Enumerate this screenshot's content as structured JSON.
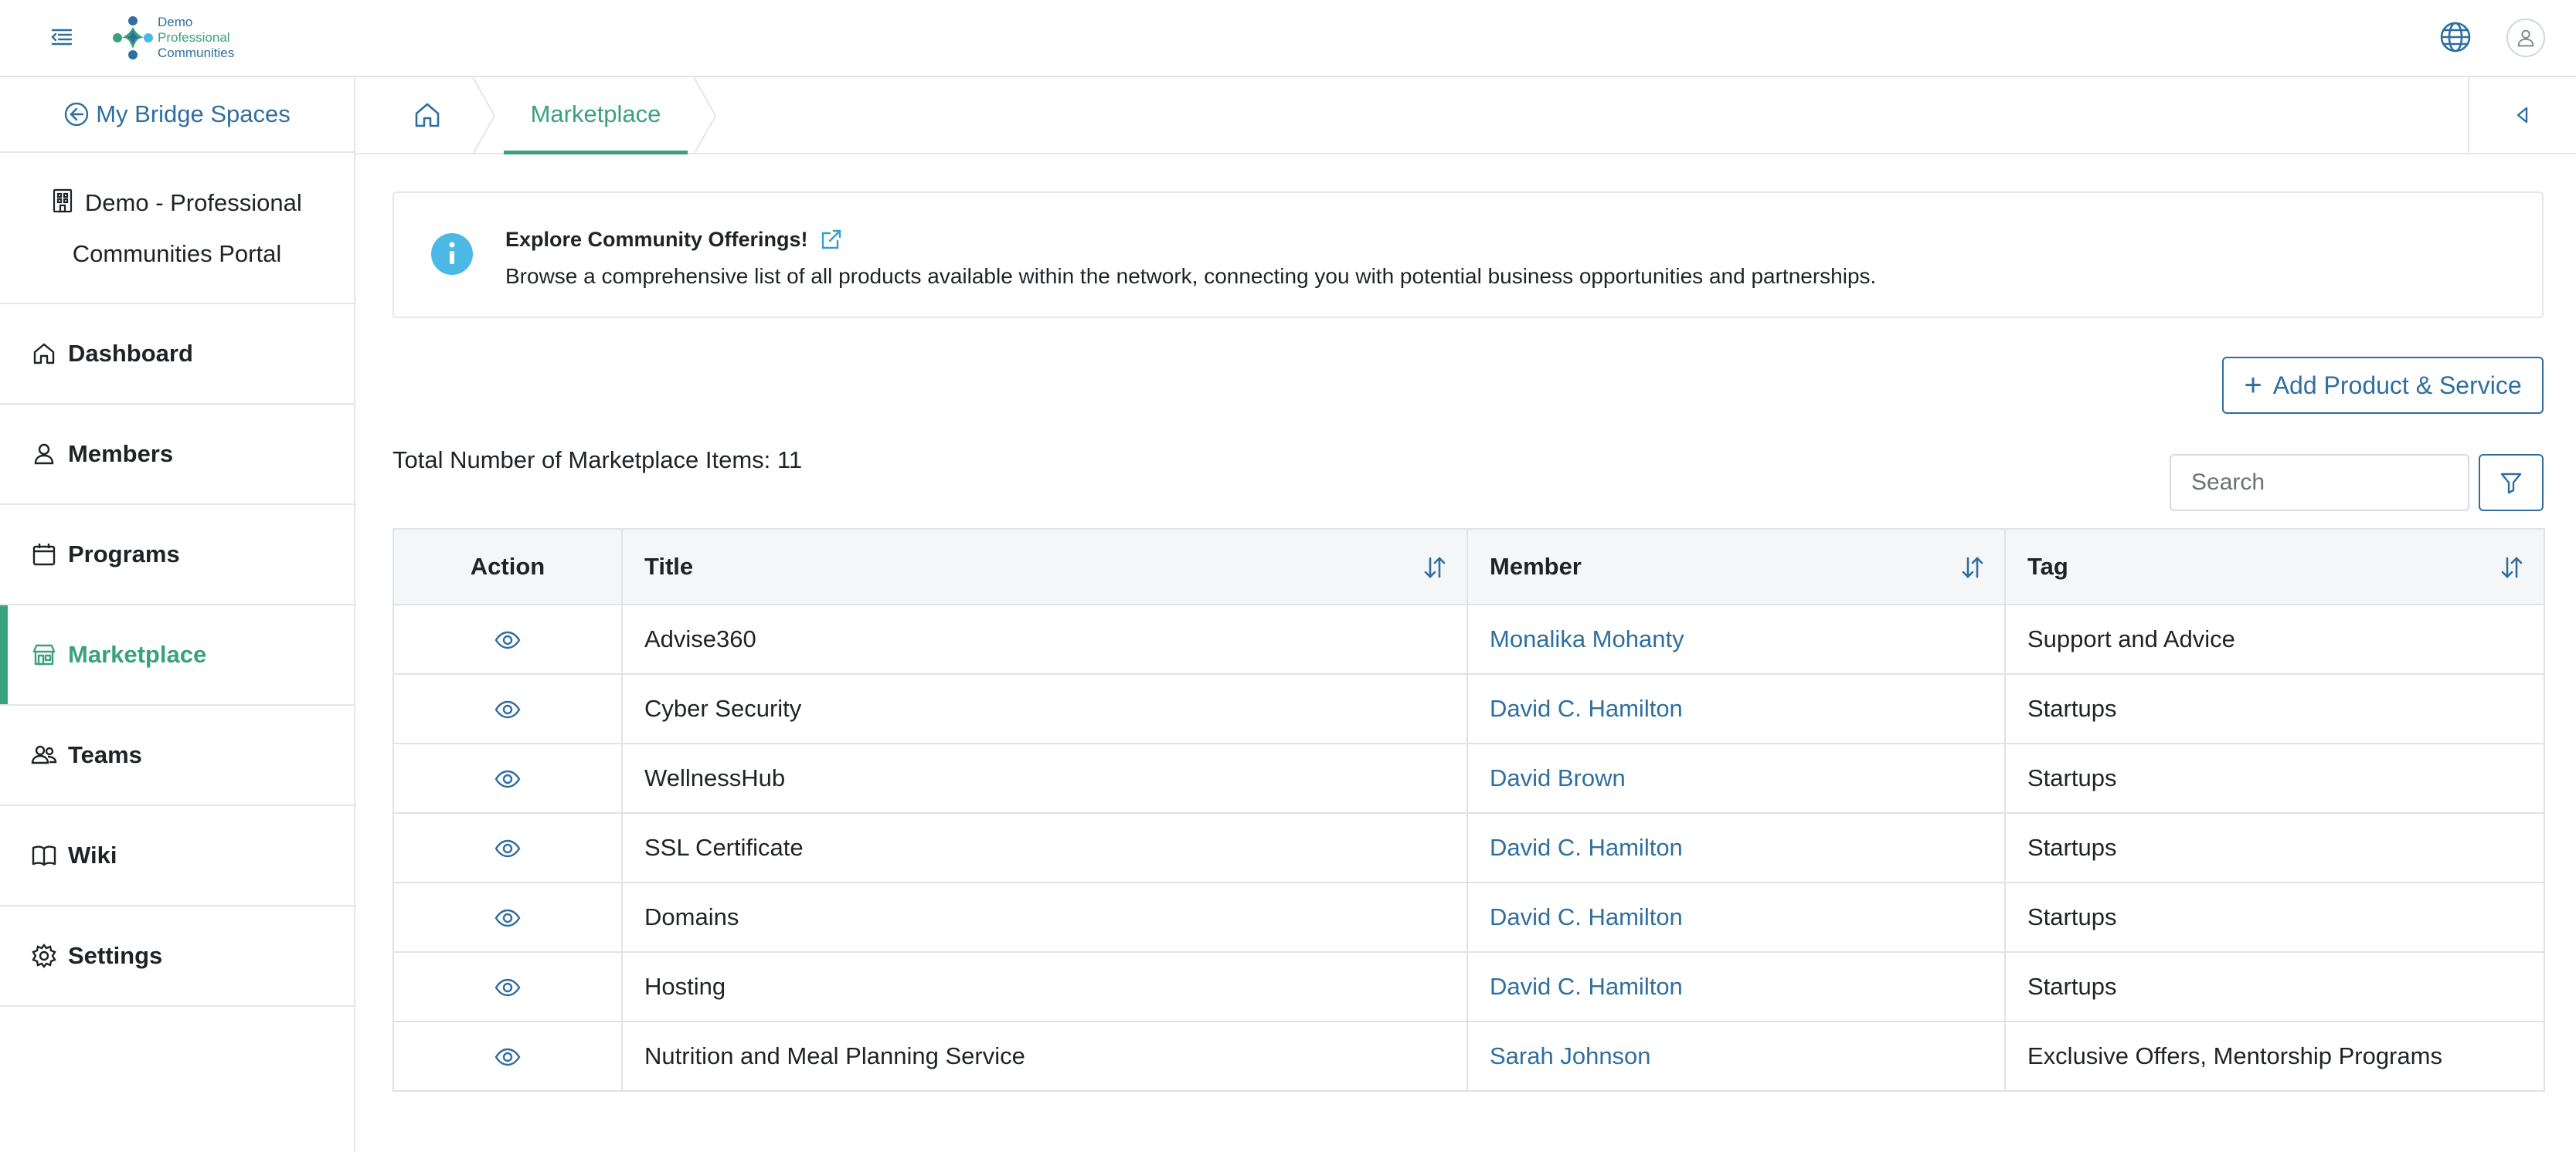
{
  "header": {
    "logo_lines": [
      "Demo",
      "Professional",
      "Communities"
    ],
    "icons": {
      "menu": "menu-collapse-icon",
      "globe": "globe-icon",
      "user": "user-icon"
    }
  },
  "sidebar": {
    "back_link": "My Bridge Spaces",
    "portal_line1": "Demo - Professional",
    "portal_line2": "Communities Portal",
    "items": [
      {
        "label": "Dashboard",
        "icon": "home-icon",
        "active": false
      },
      {
        "label": "Members",
        "icon": "user-icon",
        "active": false
      },
      {
        "label": "Programs",
        "icon": "calendar-icon",
        "active": false
      },
      {
        "label": "Marketplace",
        "icon": "store-icon",
        "active": true
      },
      {
        "label": "Teams",
        "icon": "users-icon",
        "active": false
      },
      {
        "label": "Wiki",
        "icon": "book-icon",
        "active": false
      },
      {
        "label": "Settings",
        "icon": "gear-icon",
        "active": false
      }
    ]
  },
  "breadcrumb": {
    "current": "Marketplace"
  },
  "info": {
    "title": "Explore Community Offerings!",
    "description": "Browse a comprehensive list of all products available within the network, connecting you with potential business opportunities and partnerships."
  },
  "actions": {
    "add_label": "Add Product & Service",
    "search_placeholder": "Search"
  },
  "total_label": "Total Number of Marketplace Items: 11",
  "table": {
    "columns": [
      "Action",
      "Title",
      "Member",
      "Tag"
    ],
    "rows": [
      {
        "title": "Advise360",
        "member": "Monalika Mohanty",
        "tag": "Support and Advice"
      },
      {
        "title": "Cyber Security",
        "member": "David C. Hamilton",
        "tag": "Startups"
      },
      {
        "title": "WellnessHub",
        "member": "David Brown",
        "tag": "Startups"
      },
      {
        "title": "SSL Certificate",
        "member": "David C. Hamilton",
        "tag": "Startups"
      },
      {
        "title": "Domains",
        "member": "David C. Hamilton",
        "tag": "Startups"
      },
      {
        "title": "Hosting",
        "member": "David C. Hamilton",
        "tag": "Startups"
      },
      {
        "title": "Nutrition and Meal Planning Service",
        "member": "Sarah Johnson",
        "tag": "Exclusive Offers, Mentorship Programs"
      }
    ]
  },
  "colors": {
    "accent_green": "#3aa17e",
    "link_blue": "#2f6e9e",
    "info_blue": "#4bb8e6",
    "border": "#e3e6ea"
  }
}
